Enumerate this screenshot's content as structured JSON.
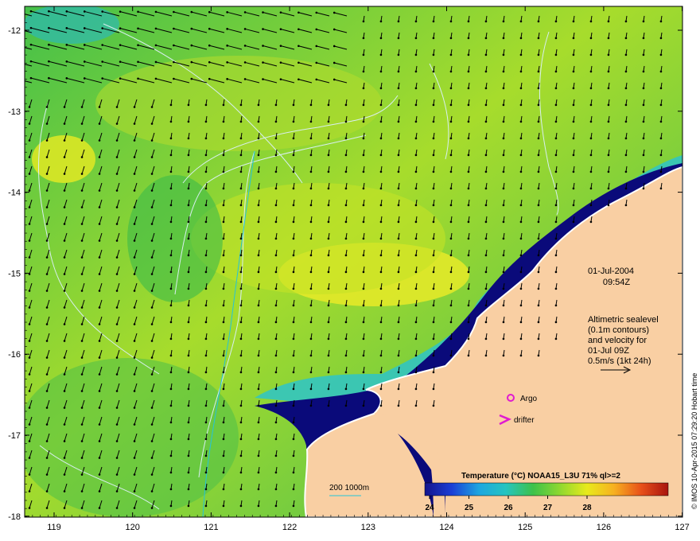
{
  "map": {
    "lon_ticks": [
      "119",
      "120",
      "121",
      "122",
      "123",
      "124",
      "125",
      "126",
      "127"
    ],
    "lat_ticks": [
      "-12",
      "-13",
      "-14",
      "-15",
      "-16",
      "-17",
      "-18"
    ],
    "colors": {
      "land": "#f9cfa3",
      "coast": "#ffffff",
      "deep_blue": "#0a0a7a",
      "cyan": "#25c4d8",
      "green": "#3bc24a",
      "yellow_green": "#c8e418",
      "yellow": "#f2ee20",
      "contour": "#d8eef0",
      "arrow": "#000000"
    }
  },
  "overlay": {
    "date": "01-Jul-2004",
    "time": "09:54Z",
    "sealevel_note": [
      "Altimetric sealevel",
      "(0.1m contours)",
      "and velocity for",
      "01-Jul 09Z",
      "0.5m/s (1kt 24h)"
    ]
  },
  "legend": {
    "argo": "Argo",
    "drifter": "drifter",
    "isobath": "200  1000m"
  },
  "colorbar": {
    "title": "Temperature (°C) NOAA15_L3U 71% ql>=2",
    "ticks": [
      "24",
      "25",
      "26",
      "27",
      "28"
    ],
    "stops": [
      "#14148c",
      "#1b3fd6",
      "#1ea6e0",
      "#25c4c0",
      "#3dc24a",
      "#8fd830",
      "#e8ea1c",
      "#f7b020",
      "#e8501a",
      "#a8140e"
    ]
  },
  "credit": "© IMOS 10-Apr-2015 07:29:20 Hobart time"
}
